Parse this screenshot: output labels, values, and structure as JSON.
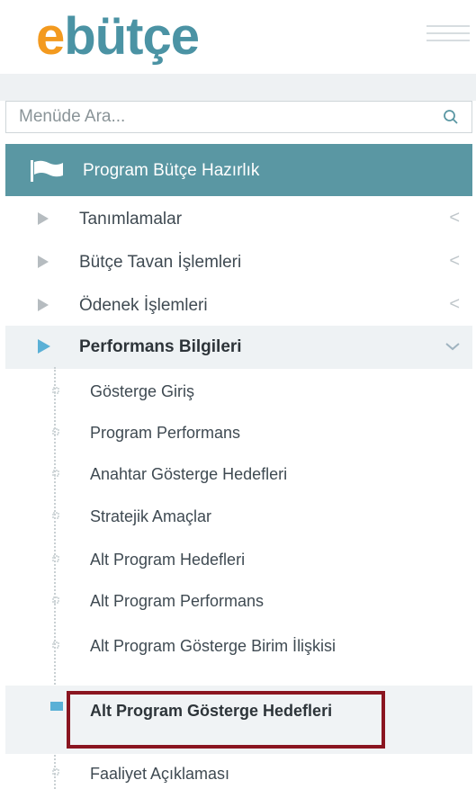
{
  "logo": {
    "e": "e",
    "rest": "bütçe"
  },
  "search": {
    "placeholder": "Menüde Ara..."
  },
  "section": {
    "title": "Program Bütçe Hazırlık"
  },
  "menu": [
    {
      "label": "Tanımlamalar",
      "chevron": "<"
    },
    {
      "label": "Bütçe Tavan İşlemleri",
      "chevron": "<"
    },
    {
      "label": "Ödenek İşlemleri",
      "chevron": "<"
    },
    {
      "label": "Performans Bilgileri",
      "expanded": true
    }
  ],
  "submenu": [
    {
      "label": "Gösterge Giriş"
    },
    {
      "label": "Program Performans"
    },
    {
      "label": "Anahtar Gösterge Hedefleri"
    },
    {
      "label": "Stratejik Amaçlar"
    },
    {
      "label": "Alt Program Hedefleri"
    },
    {
      "label": "Alt Program Performans"
    },
    {
      "label": "Alt Program Gösterge Birim İlişkisi"
    },
    {
      "label": "Alt Program Gösterge Hedefleri",
      "selected": true
    },
    {
      "label": "Faaliyet Açıklaması"
    }
  ],
  "colors": {
    "logo_orange": "#f39a1f",
    "logo_teal": "#4b93a4",
    "section_band": "#5a97a3",
    "selection_outline": "#8a1520",
    "active_marker": "#5ab0d6"
  },
  "icons": {
    "hamburger": "hamburger-menu-icon",
    "search": "search-icon",
    "section": "flag-icon",
    "menu_bullet": "triangle-right-icon",
    "collapsed": "chevron-left-icon",
    "expanded": "chevron-down-icon",
    "tree_bullet": "tree-node-icon"
  }
}
